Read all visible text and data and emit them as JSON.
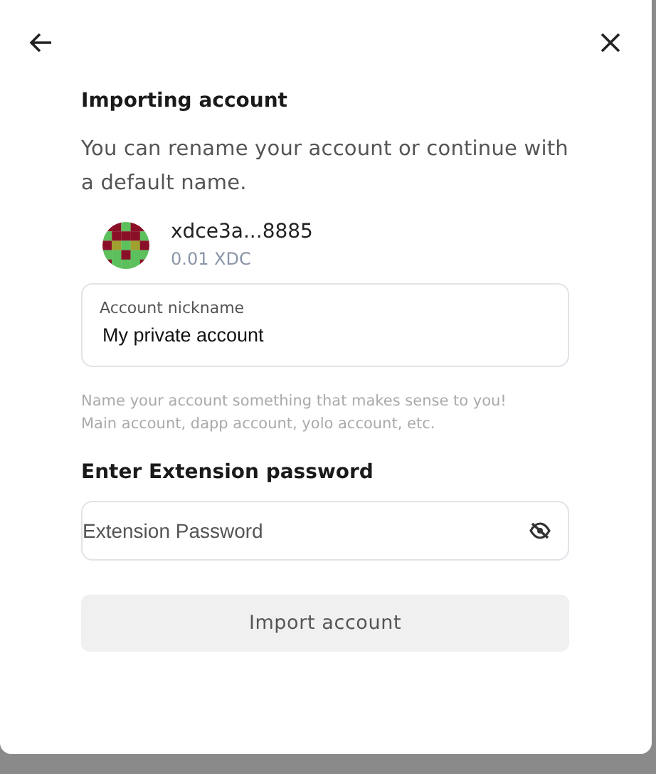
{
  "title": "Importing account",
  "description": "You can rename your account or continue with a default name.",
  "account": {
    "address": "xdce3a...8885",
    "balance": "0.01 XDC"
  },
  "nickname": {
    "label": "Account nickname",
    "value": "My private account"
  },
  "hint": "Name your account something that makes sense to you! Main account, dapp account, yolo account, etc.",
  "password_section": {
    "heading": "Enter Extension password",
    "placeholder": "Extension Password",
    "visible": false
  },
  "import_button": {
    "label": "Import account",
    "disabled": true
  }
}
